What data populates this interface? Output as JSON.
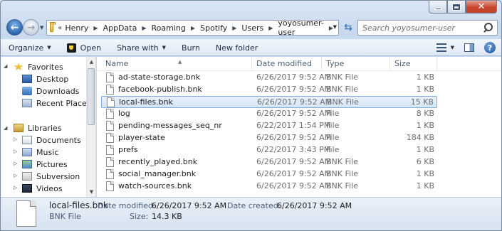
{
  "address": {
    "crumbs": [
      "Henry",
      "AppData",
      "Roaming",
      "Spotify",
      "Users",
      "yoyosumer-user"
    ]
  },
  "search": {
    "placeholder": "Search yoyosumer-user"
  },
  "commands": {
    "organize": "Organize",
    "open": "Open",
    "share_with": "Share with",
    "burn": "Burn",
    "new_folder": "New folder"
  },
  "nav": {
    "favorites": "Favorites",
    "desktop": "Desktop",
    "downloads": "Downloads",
    "recent_places": "Recent Places",
    "libraries": "Libraries",
    "documents": "Documents",
    "music": "Music",
    "pictures": "Pictures",
    "subversion": "Subversion",
    "videos": "Videos"
  },
  "columns": {
    "name": "Name",
    "date": "Date modified",
    "type": "Type",
    "size": "Size"
  },
  "files": [
    {
      "name": "ad-state-storage.bnk",
      "date": "6/26/2017 9:52 AM",
      "type": "BNK File",
      "size": "1 KB"
    },
    {
      "name": "facebook-publish.bnk",
      "date": "6/26/2017 9:52 AM",
      "type": "BNK File",
      "size": "1 KB"
    },
    {
      "name": "local-files.bnk",
      "date": "6/26/2017 9:52 AM",
      "type": "BNK File",
      "size": "15 KB"
    },
    {
      "name": "log",
      "date": "6/26/2017 9:52 AM",
      "type": "File",
      "size": "8 KB"
    },
    {
      "name": "pending-messages_seq_nr",
      "date": "6/22/2017 1:54 PM",
      "type": "File",
      "size": "1 KB"
    },
    {
      "name": "player-state",
      "date": "6/26/2017 9:52 AM",
      "type": "File",
      "size": "184 KB"
    },
    {
      "name": "prefs",
      "date": "6/22/2017 3:43 PM",
      "type": "File",
      "size": "1 KB"
    },
    {
      "name": "recently_played.bnk",
      "date": "6/26/2017 9:52 AM",
      "type": "BNK File",
      "size": "6 KB"
    },
    {
      "name": "social_manager.bnk",
      "date": "6/26/2017 9:52 AM",
      "type": "BNK File",
      "size": "1 KB"
    },
    {
      "name": "watch-sources.bnk",
      "date": "6/26/2017 9:52 AM",
      "type": "BNK File",
      "size": "1 KB"
    }
  ],
  "selected_index": 2,
  "details": {
    "name": "local-files.bnk",
    "type": "BNK File",
    "date_modified_label": "Date modified:",
    "date_modified": "6/26/2017 9:52 AM",
    "date_created_label": "Date created:",
    "date_created": "6/26/2017 9:52 AM",
    "size_label": "Size:",
    "size": "14.3 KB"
  }
}
